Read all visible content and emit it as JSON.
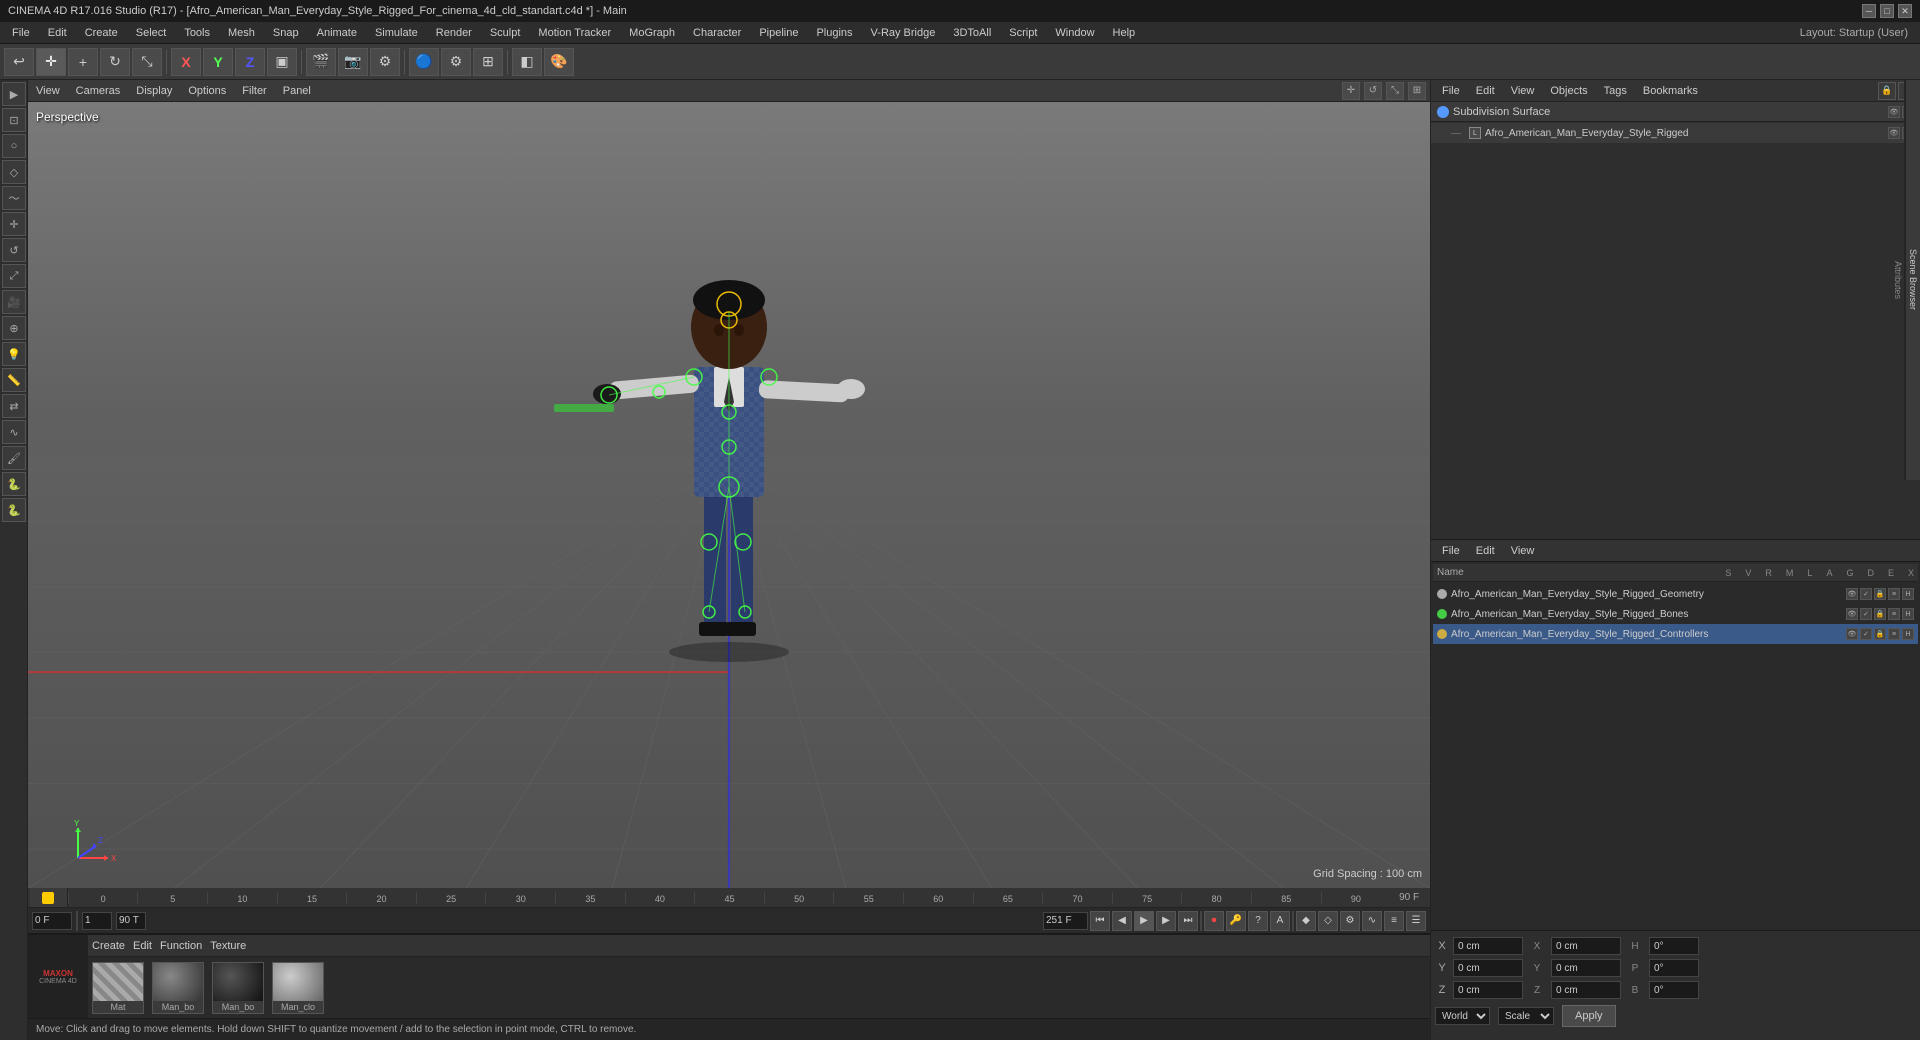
{
  "titlebar": {
    "title": "CINEMA 4D R17.016 Studio (R17) - [Afro_American_Man_Everyday_Style_Rigged_For_cinema_4d_cld_standart.c4d *] - Main",
    "minimize": "─",
    "maximize": "□",
    "close": "✕"
  },
  "menubar": {
    "items": [
      "File",
      "Edit",
      "Create",
      "Select",
      "Tools",
      "Mesh",
      "Snap",
      "Animate",
      "Simulate",
      "Render",
      "Sculpt",
      "Motion Tracker",
      "MoGraph",
      "Character",
      "Pipeline",
      "Plugins",
      "V-Ray Bridge",
      "3DToAll",
      "Script",
      "Window",
      "Help"
    ],
    "layout_label": "Layout: Startup (User)"
  },
  "viewport": {
    "perspective_label": "Perspective",
    "grid_spacing": "Grid Spacing : 100 cm",
    "toolbar_items": [
      "View",
      "Cameras",
      "Display",
      "Options",
      "Filter",
      "Panel"
    ]
  },
  "timeline": {
    "frame_start": "0 F",
    "frame_end": "251 F",
    "current_frame": "0 F",
    "marks": [
      "0",
      "5",
      "10",
      "15",
      "20",
      "25",
      "30",
      "35",
      "40",
      "45",
      "50",
      "55",
      "60",
      "65",
      "70",
      "75",
      "80",
      "85",
      "90"
    ],
    "frame_display": "0 F",
    "end_frame": "90 F"
  },
  "material_panel": {
    "toolbar_items": [
      "Create",
      "Edit",
      "Function",
      "Texture"
    ],
    "materials": [
      {
        "name": "Mat",
        "type": "checker"
      },
      {
        "name": "Man_bo",
        "type": "sphere-dark"
      },
      {
        "name": "Man_bo",
        "type": "sphere-dark2"
      },
      {
        "name": "Man_clo",
        "type": "sphere-light"
      }
    ]
  },
  "status_bar": {
    "text": "Move: Click and drag to move elements. Hold down SHIFT to quantize movement / add to the selection in point mode, CTRL to remove."
  },
  "right_panel": {
    "top_tabs": [
      "File",
      "Edit",
      "View",
      "Objects",
      "Tags",
      "Bookmarks"
    ],
    "object_tree": {
      "items": [
        {
          "name": "Subdivision Surface",
          "color": "#5599ff",
          "type": "subdiv"
        },
        {
          "name": "Afro_American_Man_Everyday_Style_Rigged",
          "color": "#aaaaaa",
          "type": "item",
          "indent": 1
        }
      ]
    },
    "bottom_tabs": [
      "File",
      "Edit",
      "View"
    ],
    "obj_columns": [
      "Name",
      "S",
      "V",
      "R",
      "M",
      "L",
      "A",
      "G",
      "D",
      "E",
      "X"
    ],
    "objects": [
      {
        "name": "Afro_American_Man_Everyday_Style_Rigged_Geometry",
        "color": "#aaaaaa",
        "indent": 0
      },
      {
        "name": "Afro_American_Man_Everyday_Style_Rigged_Bones",
        "color": "#44cc44",
        "indent": 0
      },
      {
        "name": "Afro_American_Man_Everyday_Style_Rigged_Controllers",
        "color": "#ccaa44",
        "indent": 0
      }
    ],
    "vertical_tabs": [
      "Scene Browser",
      "Attributes"
    ]
  },
  "coord_panel": {
    "x_pos": "0 cm",
    "y_pos": "0 cm",
    "z_pos": "0 cm",
    "x_size": "0 cm",
    "y_size": "0 cm",
    "z_size": "0 cm",
    "h_rot": "0°",
    "p_rot": "0°",
    "b_rot": "0°",
    "coord_system": "World",
    "transform_mode": "Scale",
    "apply_label": "Apply",
    "labels": {
      "x": "X",
      "y": "Y",
      "z": "Z",
      "pos": "0 cm",
      "size_x": "0 cm",
      "size_y": "0 cm",
      "h": "H",
      "p": "P",
      "b": "B"
    }
  },
  "icons": {
    "move": "✛",
    "rotate": "↻",
    "scale": "⤡",
    "select": "▣",
    "undo": "↩",
    "redo": "↪",
    "play": "▶",
    "stop": "■",
    "prev": "◀",
    "next": "▶",
    "first": "⏮",
    "last": "⏭",
    "record": "⏺",
    "perspective_icon": "⊞",
    "axes": "⊕"
  }
}
